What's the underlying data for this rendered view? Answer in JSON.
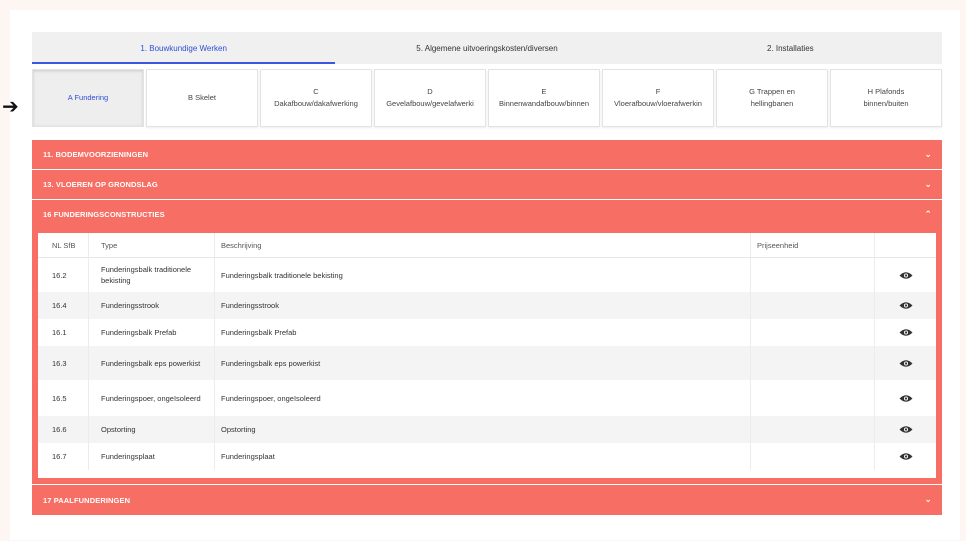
{
  "colors": {
    "accent": "#f76e64",
    "active_tab": "#3b57e0"
  },
  "arrow": "➔",
  "tabs": [
    {
      "label": "1. Bouwkundige Werken",
      "active": true
    },
    {
      "label": "5. Algemene uitvoeringskosten/diversen",
      "active": false
    },
    {
      "label": "2. Installaties",
      "active": false
    }
  ],
  "subtabs": [
    {
      "label": "A Fundering",
      "active": true
    },
    {
      "label": "B Skelet"
    },
    {
      "label": "C\nDakafbouw/dakafwerking"
    },
    {
      "label": "D\nGevelafbouw/gevelafwerki"
    },
    {
      "label": "E\nBinnenwandafbouw/binnen"
    },
    {
      "label": "F\nVloerafbouw/vloerafwerkin"
    },
    {
      "label": "G Trappen en\nhellingbanen"
    },
    {
      "label": "H Plafonds\nbinnen/buiten"
    }
  ],
  "accordion": {
    "s11": {
      "title": "11. BODEMVOORZIENINGEN",
      "icon": "chevron-down-icon"
    },
    "s13": {
      "title": "13. VLOEREN OP GRONDSLAG",
      "icon": "chevron-down-icon"
    },
    "s16": {
      "title": "16 FUNDERINGSCONSTRUCTIES",
      "icon": "chevron-up-icon"
    },
    "s17": {
      "title": "17 PAALFUNDERINGEN",
      "icon": "chevron-down-icon"
    }
  },
  "table": {
    "headers": {
      "nlsfb": "NL SfB",
      "type": "Type",
      "beschrijving": "Beschrijving",
      "prijseenheid": "Prijseenheid"
    },
    "rows": [
      {
        "nlsfb": "16.2",
        "type": "Funderingsbalk traditionele bekisting",
        "beschrijving": "Funderingsbalk traditionele bekisting",
        "prijseenheid": ""
      },
      {
        "nlsfb": "16.4",
        "type": "Funderingsstrook",
        "beschrijving": "Funderingsstrook",
        "prijseenheid": ""
      },
      {
        "nlsfb": "16.1",
        "type": "Funderingsbalk Prefab",
        "beschrijving": "Funderingsbalk Prefab",
        "prijseenheid": ""
      },
      {
        "nlsfb": "16.3",
        "type": "Funderingsbalk eps powerkist",
        "beschrijving": "Funderingsbalk eps powerkist",
        "prijseenheid": ""
      },
      {
        "nlsfb": "16.5",
        "type": "Funderingspoer, ongeïsoleerd",
        "beschrijving": "Funderingspoer, ongeïsoleerd",
        "prijseenheid": ""
      },
      {
        "nlsfb": "16.6",
        "type": "Opstorting",
        "beschrijving": "Opstorting",
        "prijseenheid": ""
      },
      {
        "nlsfb": "16.7",
        "type": "Funderingsplaat",
        "beschrijving": "Funderingsplaat",
        "prijseenheid": ""
      }
    ],
    "row_icon": "eye-icon"
  }
}
